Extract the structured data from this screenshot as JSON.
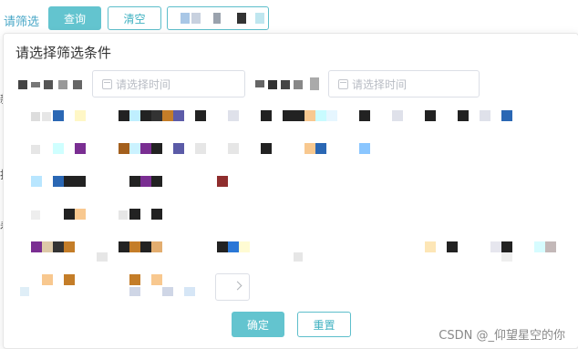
{
  "toolbar": {
    "filter_label": "请筛选",
    "query_button": "查询",
    "clear_button": "清空"
  },
  "panel": {
    "title": "请选择筛选条件",
    "date_start_placeholder": "请选择时间",
    "date_end_placeholder": "请选择时间",
    "confirm_button": "确定",
    "reset_button": "重置"
  },
  "watermark": "CSDN @_仰望星空的你",
  "colors": {
    "accent": "#63c4cf",
    "accent_text": "#3fb1c1",
    "link": "#49a7c7",
    "border": "#dcdfe6"
  }
}
